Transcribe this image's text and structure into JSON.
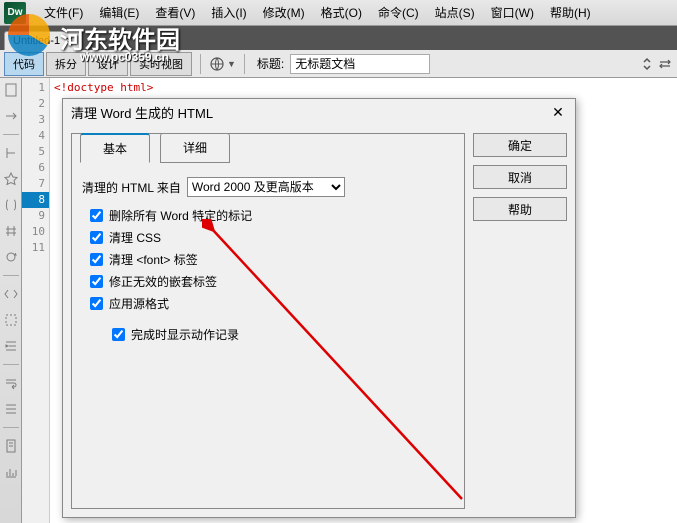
{
  "menu": {
    "logo": "Dw",
    "items": [
      "文件(F)",
      "编辑(E)",
      "查看(V)",
      "插入(I)",
      "修改(M)",
      "格式(O)",
      "命令(C)",
      "站点(S)",
      "窗口(W)",
      "帮助(H)"
    ]
  },
  "watermark": {
    "text": "河东软件园",
    "url": "www.pc0359.cn"
  },
  "docTab": {
    "name": "Untitled-1",
    "close": "×"
  },
  "viewButtons": [
    "代码",
    "拆分",
    "设计",
    "实时视图"
  ],
  "toolbar": {
    "titleLabel": "标题:",
    "titleValue": "无标题文档"
  },
  "gutter": {
    "lines": [
      "1",
      "2",
      "3",
      "4",
      "5",
      "6",
      "7",
      "8",
      "9",
      "10",
      "11"
    ],
    "active": 8
  },
  "code": {
    "line1": "<!doctype html>"
  },
  "dialog": {
    "title": "清理 Word 生成的 HTML",
    "tabs": [
      "基本",
      "详细"
    ],
    "sourceLabel": "清理的 HTML 来自",
    "sourceOptions": [
      "Word 2000 及更高版本"
    ],
    "checks": [
      "删除所有 Word 特定的标记",
      "清理 CSS",
      "清理 <font> 标签",
      "修正无效的嵌套标签",
      "应用源格式"
    ],
    "logCheck": "完成时显示动作记录",
    "buttons": {
      "ok": "确定",
      "cancel": "取消",
      "help": "帮助"
    }
  }
}
